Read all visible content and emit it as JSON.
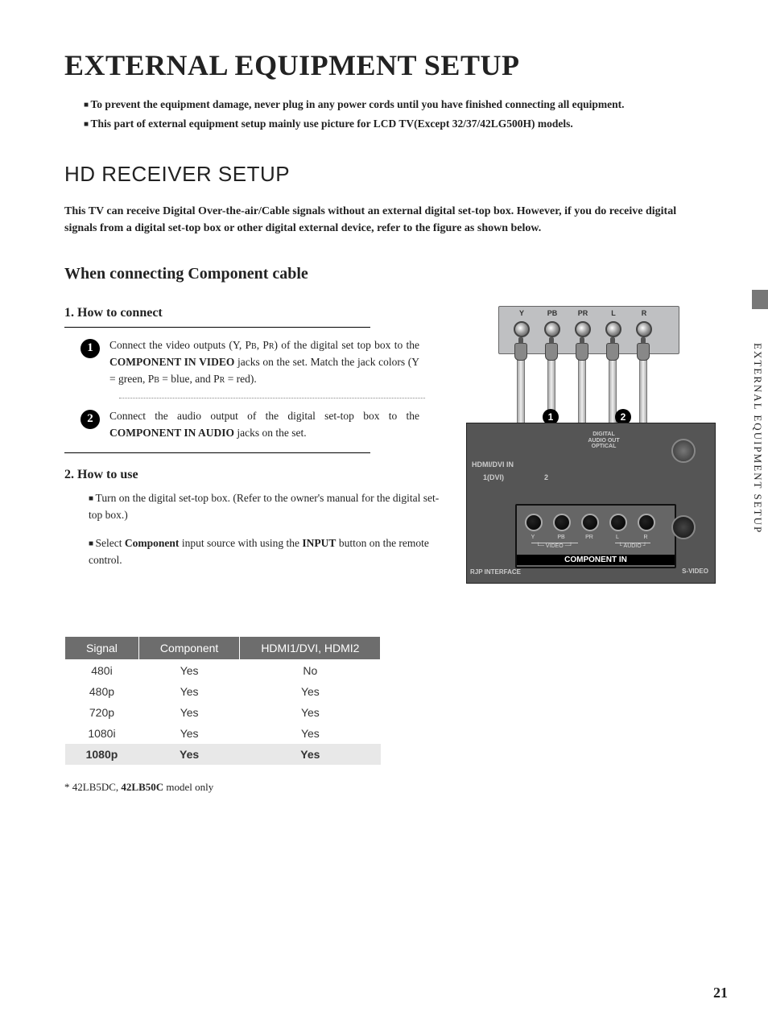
{
  "page": {
    "title": "EXTERNAL EQUIPMENT SETUP",
    "side_tab": "EXTERNAL EQUIPMENT SETUP",
    "number": "21"
  },
  "warnings": [
    "To prevent the equipment damage, never plug in any power cords until you have finished connecting all equipment.",
    "This part of external equipment setup mainly use picture for LCD TV(Except 32/37/42LG500H) models."
  ],
  "section": {
    "title": "HD RECEIVER SETUP",
    "intro": "This TV can receive Digital Over-the-air/Cable signals without an external digital set-top box. However, if you do receive digital signals from a digital set-top box or other digital external device, refer to the figure as shown below.",
    "sub_title": "When connecting Component cable"
  },
  "how_to_connect": {
    "heading": "1. How to connect",
    "steps": [
      {
        "num": "1",
        "pre": "Connect the video outputs (Y, P",
        "b_small": "B",
        "mid1": ", P",
        "r_small": "R",
        "mid2": ") of the digital set top box to the ",
        "bold1": "COMPONENT IN VIDEO",
        "mid3": " jacks on the set. Match the jack colors (Y = green, P",
        "b_small2": "B",
        "mid4": " = blue, and P",
        "r_small2": "R",
        "mid5": " = red)."
      },
      {
        "num": "2",
        "pre": "Connect the audio output of the digital set-top box to the ",
        "bold1": "COMPONENT IN AUDIO",
        "post": " jacks on the set."
      }
    ]
  },
  "how_to_use": {
    "heading": "2. How to use",
    "items": [
      {
        "plain": "Turn on the digital set-top box. (Refer to the owner's manual for the digital set-top box.)"
      },
      {
        "pre": "Select ",
        "bold1": "Component",
        "mid": " input source with using the ",
        "bold2": "INPUT",
        "post": " button on the remote control."
      }
    ]
  },
  "diagram": {
    "stb_jacks": [
      "Y",
      "PB",
      "PR",
      "L",
      "R"
    ],
    "badge1": "1",
    "badge2": "2",
    "hdmi_label": "HDMI/DVI IN",
    "hdmi_sub": "1(DVI)",
    "hdmi_sub2": "2",
    "digital_audio": "DIGITAL AUDIO OUT OPTICAL",
    "rjp": "RJP INTERFACE",
    "svideo": "S-VIDEO",
    "video_label": "VIDEO",
    "audio_label": "AUDIO",
    "y": "Y",
    "pb": "PB",
    "pr": "PR",
    "l": "L",
    "r": "R",
    "component_in": "COMPONENT IN"
  },
  "chart_data": {
    "type": "table",
    "title": "",
    "columns": [
      "Signal",
      "Component",
      "HDMI1/DVI, HDMI2"
    ],
    "rows": [
      {
        "signal": "480i",
        "component": "Yes",
        "hdmi": "No"
      },
      {
        "signal": "480p",
        "component": "Yes",
        "hdmi": "Yes"
      },
      {
        "signal": "720p",
        "component": "Yes",
        "hdmi": "Yes"
      },
      {
        "signal": "1080i",
        "component": "Yes",
        "hdmi": "Yes"
      },
      {
        "signal": "1080p",
        "component": "Yes",
        "hdmi": "Yes"
      }
    ]
  },
  "footnote": {
    "pre": "* 42LB5DC, ",
    "bold": "42LB50C",
    "post": " model only"
  }
}
